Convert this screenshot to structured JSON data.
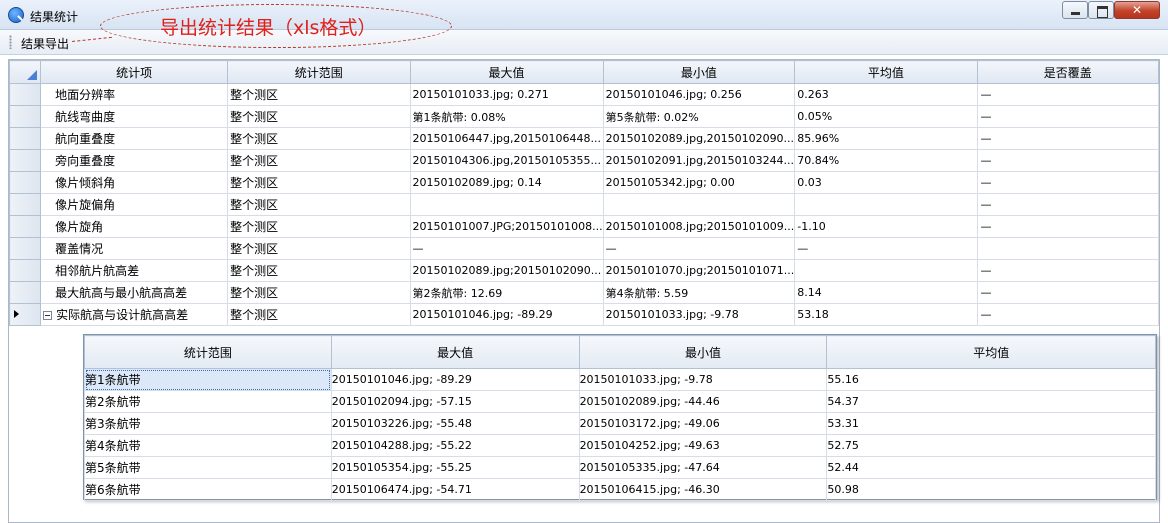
{
  "window": {
    "title": "结果统计"
  },
  "annotation": {
    "text": "导出统计结果（xls格式）"
  },
  "toolbar": {
    "export_label": "结果导出"
  },
  "main_table": {
    "columns": [
      "统计项",
      "统计范围",
      "最大值",
      "最小值",
      "平均值",
      "是否覆盖"
    ],
    "rows": [
      [
        "地面分辨率",
        "整个测区",
        "20150101033.jpg; 0.271",
        "20150101046.jpg; 0.256",
        "0.263",
        "—"
      ],
      [
        "航线弯曲度",
        "整个测区",
        "第1条航带: 0.08%",
        "第5条航带: 0.02%",
        "0.05%",
        "—"
      ],
      [
        "航向重叠度",
        "整个测区",
        "20150106447.jpg,20150106448...",
        "20150102089.jpg,20150102090...",
        "85.96%",
        "—"
      ],
      [
        "旁向重叠度",
        "整个测区",
        "20150104306.jpg,20150105355...",
        "20150102091.jpg,20150103244...",
        "70.84%",
        "—"
      ],
      [
        "像片倾斜角",
        "整个测区",
        "20150102089.jpg; 0.14",
        "20150105342.jpg; 0.00",
        "0.03",
        "—"
      ],
      [
        "像片旋偏角",
        "整个测区",
        "",
        "",
        "",
        "—"
      ],
      [
        "像片旋角",
        "整个测区",
        "20150101007.JPG;20150101008...",
        "20150101008.jpg;20150101009...",
        "-1.10",
        "—"
      ],
      [
        "覆盖情况",
        "整个测区",
        "—",
        "—",
        "—",
        ""
      ],
      [
        "相邻航片航高差",
        "整个测区",
        "20150102089.jpg;20150102090...",
        "20150101070.jpg;20150101071...",
        "",
        "—"
      ],
      [
        "最大航高与最小航高高差",
        "整个测区",
        "第2条航带: 12.69",
        "第4条航带: 5.59",
        "8.14",
        "—"
      ],
      [
        "实际航高与设计航高高差",
        "整个测区",
        "20150101046.jpg; -89.29",
        "20150101033.jpg; -9.78",
        "53.18",
        "—"
      ]
    ]
  },
  "detail_table": {
    "columns": [
      "统计范围",
      "最大值",
      "最小值",
      "平均值"
    ],
    "rows": [
      [
        "第1条航带",
        "20150101046.jpg; -89.29",
        "20150101033.jpg; -9.78",
        "55.16"
      ],
      [
        "第2条航带",
        "20150102094.jpg; -57.15",
        "20150102089.jpg; -44.46",
        "54.37"
      ],
      [
        "第3条航带",
        "20150103226.jpg; -55.48",
        "20150103172.jpg; -49.06",
        "53.31"
      ],
      [
        "第4条航带",
        "20150104288.jpg; -55.22",
        "20150104252.jpg; -49.63",
        "52.75"
      ],
      [
        "第5条航带",
        "20150105354.jpg; -55.25",
        "20150105335.jpg; -47.64",
        "52.44"
      ],
      [
        "第6条航带",
        "20150106474.jpg; -54.71",
        "20150106415.jpg; -46.30",
        "50.98"
      ]
    ]
  },
  "icons": {
    "app": "search-globe-icon",
    "expander": "collapse-icon",
    "current_row": "row-pointer-icon"
  },
  "colors": {
    "annotation": "#e0201a",
    "header_bg": "#dfe7f2",
    "selected_cell": "#dce8f8"
  }
}
